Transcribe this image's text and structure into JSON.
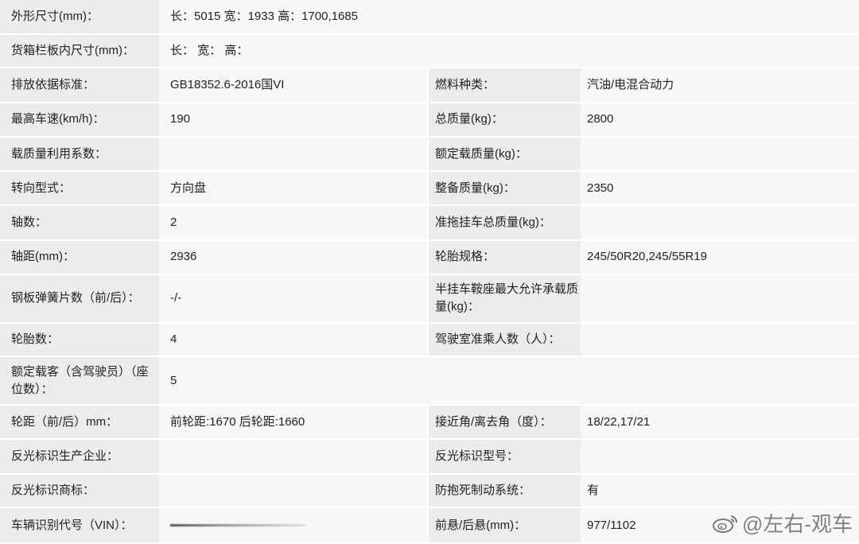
{
  "rows": [
    {
      "label": "外形尺寸(mm)：",
      "value": "长：5015 宽：1933 高：1700,1685"
    },
    {
      "label": "货箱栏板内尺寸(mm)：",
      "value": "长：  宽：  高："
    },
    {
      "label": "排放依据标准：",
      "value": "GB18352.6-2016国VI",
      "label2": "燃料种类：",
      "value2": "汽油/电混合动力"
    },
    {
      "label": "最高车速(km/h)：",
      "value": "190",
      "label2": "总质量(kg)：",
      "value2": "2800"
    },
    {
      "label": "载质量利用系数：",
      "value": "",
      "label2": "额定载质量(kg)：",
      "value2": ""
    },
    {
      "label": "转向型式：",
      "value": "方向盘",
      "label2": "整备质量(kg)：",
      "value2": "2350"
    },
    {
      "label": "轴数：",
      "value": "2",
      "label2": "准拖挂车总质量(kg)：",
      "value2": ""
    },
    {
      "label": "轴距(mm)：",
      "value": "2936",
      "label2": "轮胎规格：",
      "value2": "245/50R20,245/55R19"
    },
    {
      "label": "钢板弹簧片数（前/后）：",
      "value": "-/-",
      "label2": "半挂车鞍座最大允许承载质量(kg)：",
      "value2": ""
    },
    {
      "label": "轮胎数：",
      "value": "4",
      "label2": "驾驶室准乘人数（人）：",
      "value2": ""
    },
    {
      "label": "额定载客（含驾驶员）（座位数）：",
      "value": "5"
    },
    {
      "label": "轮距（前/后）mm：",
      "value": "前轮距:1670 后轮距:1660",
      "label2": "接近角/离去角（度）：",
      "value2": "18/22,17/21"
    },
    {
      "label": "反光标识生产企业：",
      "value": "",
      "label2": "反光标识型号：",
      "value2": ""
    },
    {
      "label": "反光标识商标：",
      "value": "",
      "label2": "防抱死制动系统：",
      "value2": "有"
    },
    {
      "label": "车辆识别代号（VIN）：",
      "value": "",
      "label2": "前悬/后悬(mm)：",
      "value2": "977/1102"
    }
  ],
  "watermark": {
    "text": "@左右-观车",
    "icon": "weibo-icon"
  }
}
